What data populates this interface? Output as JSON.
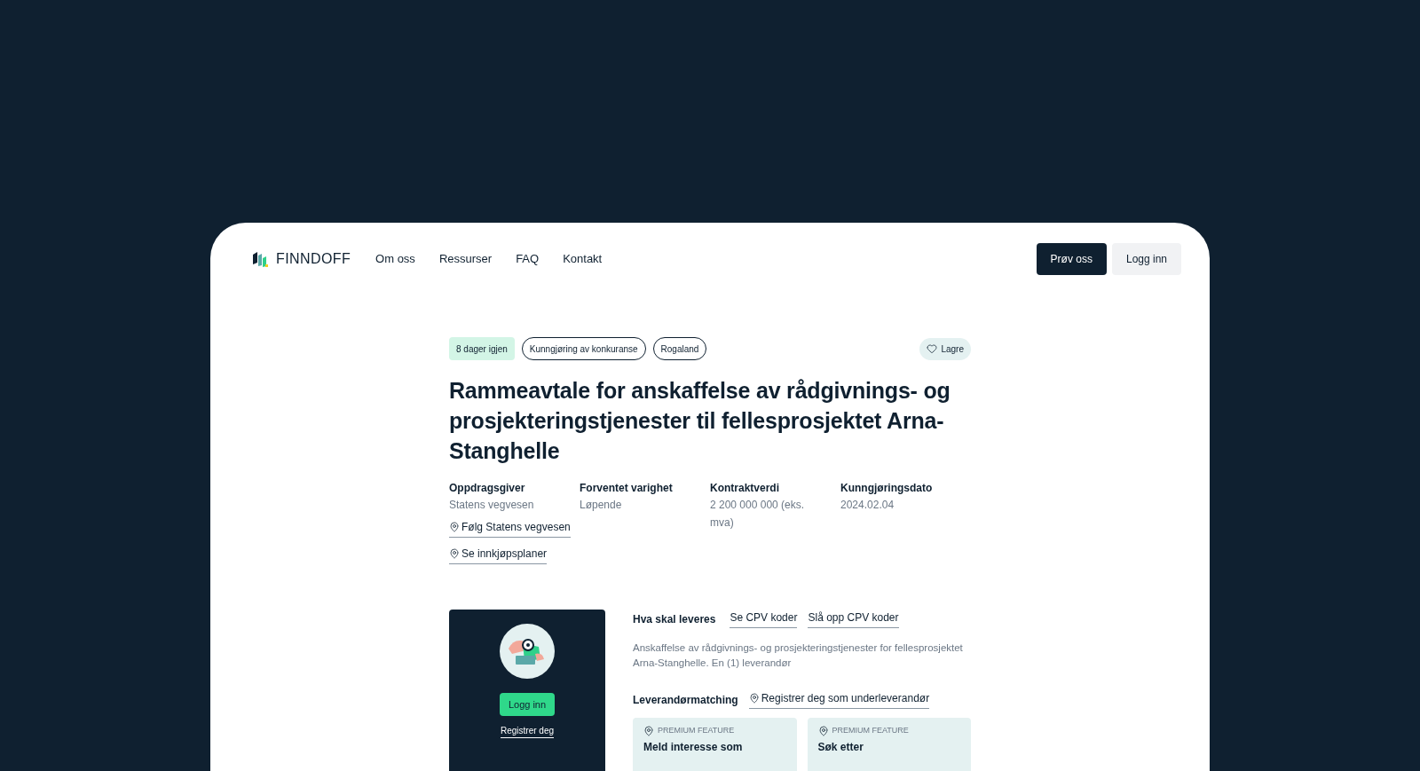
{
  "nav": {
    "brand": "FINNDOFF",
    "links": [
      "Om oss",
      "Ressurser",
      "FAQ",
      "Kontakt"
    ],
    "buttons": [
      {
        "label": "Prøv oss",
        "kind": "primary"
      },
      {
        "label": "Logg inn",
        "kind": "secondary"
      }
    ]
  },
  "tags": [
    {
      "label": "8 dager igjen",
      "kind": "deadline"
    },
    {
      "label": "Kunngjøring av konkuranse",
      "kind": "outline"
    },
    {
      "label": "Rogaland",
      "kind": "outline"
    }
  ],
  "save_button": "Lagre",
  "title": "Rammeavtale for anskaffelse av rådgivnings- og prosjekteringstjenester til fellesprosjektet Arna-Stanghelle",
  "facts": [
    {
      "label": "Oppdragsgiver",
      "value": "Statens vegvesen",
      "links": [
        "Følg Statens vegvesen",
        "Se innkjøpsplaner"
      ]
    },
    {
      "label": "Forventet varighet",
      "value": "Løpende"
    },
    {
      "label": "Kontraktverdi",
      "value": "2 200 000 000 (eks. mva)"
    },
    {
      "label": "Kunngjøringsdato",
      "value": "2024.02.04"
    }
  ],
  "login_card": {
    "button": "Logg inn",
    "link": "Registrer deg"
  },
  "deliverables": {
    "heading": "Hva skal leveres",
    "links": [
      "Se CPV koder",
      "Slå opp CPV koder"
    ],
    "description": "Anskaffelse av rådgivnings- og prosjekteringstjenester for fellesprosjektet Arna-Stanghelle. En (1) leverandør"
  },
  "matching": {
    "heading": "Leverandørmatching",
    "link": "Registrer deg som underleverandør",
    "cards": [
      {
        "badge": "PREMIUM FEATURE",
        "title": "Meld interesse som"
      },
      {
        "badge": "PREMIUM FEATURE",
        "title": "Søk etter"
      }
    ]
  }
}
